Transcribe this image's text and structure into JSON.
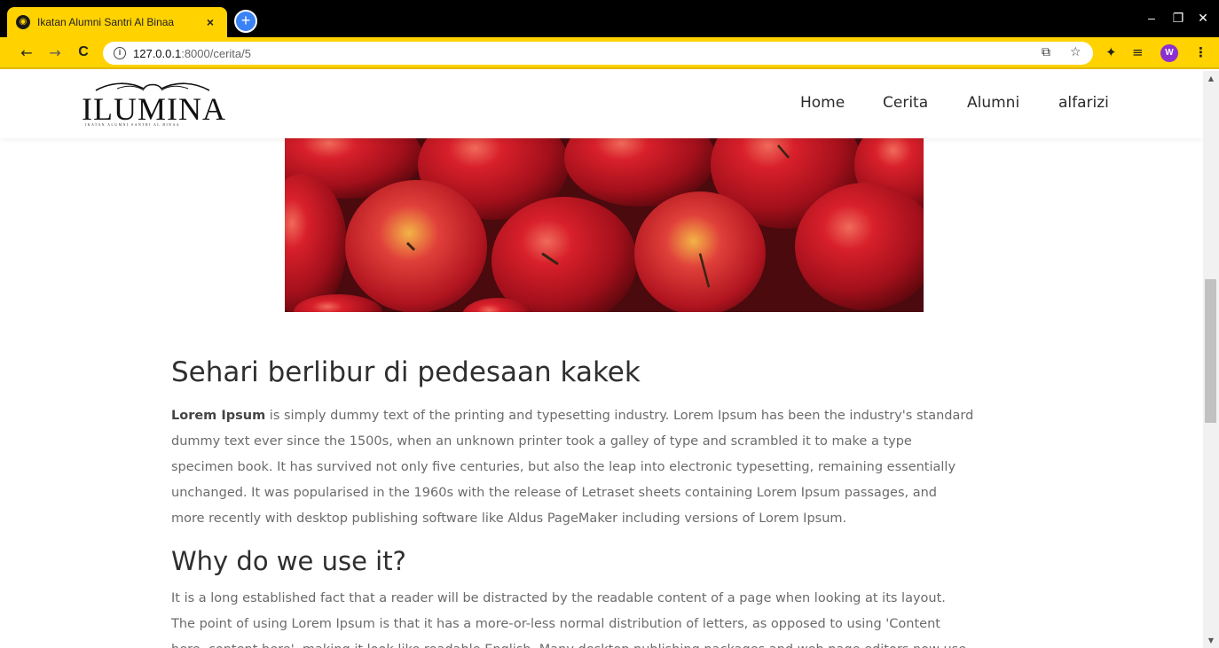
{
  "browser": {
    "tab_title": "Ikatan Alumni Santri Al Binaa",
    "tab_close": "×",
    "new_tab": "+",
    "url_host": "127.0.0.1",
    "url_path": ":8000/cerita/5",
    "nav_back": "←",
    "nav_forward": "→",
    "nav_reload": "C",
    "profile_initial": "W",
    "min": "–",
    "max": "❐",
    "close": "✕"
  },
  "site": {
    "logo_text": "ILUMINA",
    "logo_sub": "IKATAN ALUMNI SANTRI AL BINAA",
    "nav": [
      "Home",
      "Cerita",
      "Alumni",
      "alfarizi"
    ]
  },
  "article": {
    "title": "Sehari berlibur di pedesaan kakek",
    "para1_bold": "Lorem Ipsum",
    "para1_lines": [
      " is simply dummy text of the printing and typesetting industry. Lorem Ipsum has been the industry's standard",
      "dummy text ever since the 1500s, when an unknown printer took a galley of type and scrambled it to make a type",
      "specimen book. It has survived not only five centuries, but also the leap into electronic typesetting, remaining essentially",
      "unchanged. It was popularised in the 1960s with the release of Letraset sheets containing Lorem Ipsum passages, and",
      "more recently with desktop publishing software like Aldus PageMaker including versions of Lorem Ipsum."
    ],
    "heading2": "Why do we use it?",
    "para2_lines": [
      "It is a long established fact that a reader will be distracted by the readable content of a page when looking at its layout.",
      "The point of using Lorem Ipsum is that it has a more-or-less normal distribution of letters, as opposed to using 'Content",
      "here, content here', making it look like readable English. Many desktop publishing packages and web page editors now use"
    ]
  },
  "colors": {
    "chrome_accent": "#ffd200",
    "text_heading": "#2f2f2f",
    "text_body": "#6b6b6b"
  }
}
